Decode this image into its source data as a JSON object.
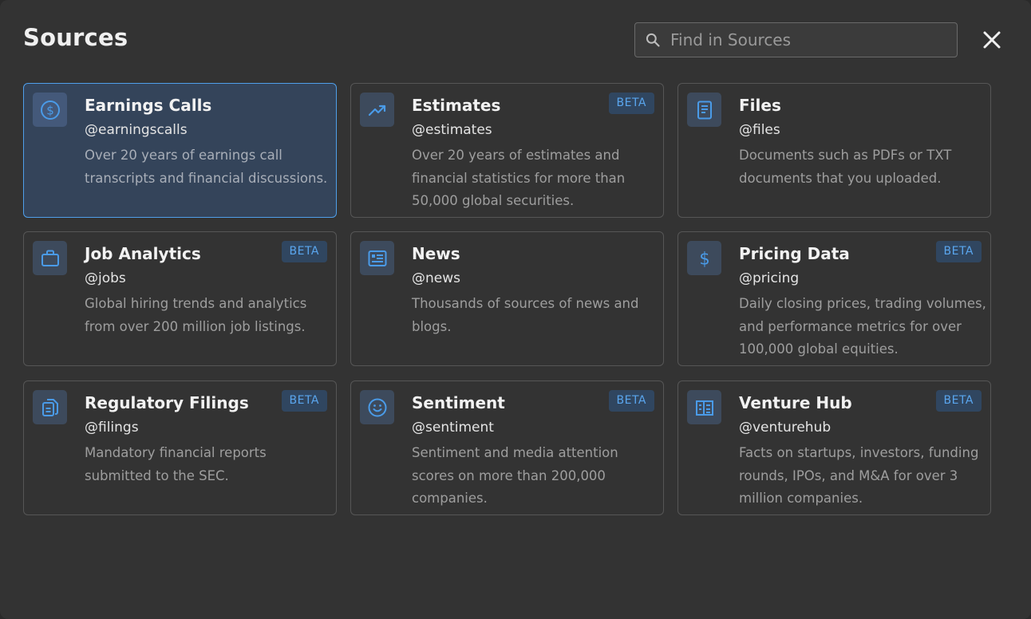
{
  "header": {
    "title": "Sources",
    "search_placeholder": "Find in Sources",
    "search_value": ""
  },
  "colors": {
    "accent": "#4f9fea",
    "badge_text": "#5aa6ee",
    "badge_bg": "#304660",
    "icon_color": "#4a9be8"
  },
  "cards": [
    {
      "name": "Earnings Calls",
      "handle": "@earningscalls",
      "desc": "Over 20 years of earnings call transcripts and financial discussions.",
      "icon": "dollar-circle-icon",
      "badge": "",
      "selected": true
    },
    {
      "name": "Estimates",
      "handle": "@estimates",
      "desc": "Over 20 years of estimates and financial statistics for more than 50,000 global securities.",
      "icon": "trending-up-icon",
      "badge": "BETA",
      "selected": false
    },
    {
      "name": "Files",
      "handle": "@files",
      "desc": "Documents such as PDFs or TXT documents that you uploaded.",
      "icon": "document-icon",
      "badge": "",
      "selected": false
    },
    {
      "name": "Job Analytics",
      "handle": "@jobs",
      "desc": "Global hiring trends and analytics from over 200 million job listings.",
      "icon": "briefcase-icon",
      "badge": "BETA",
      "selected": false
    },
    {
      "name": "News",
      "handle": "@news",
      "desc": "Thousands of sources of news and blogs.",
      "icon": "newspaper-icon",
      "badge": "",
      "selected": false
    },
    {
      "name": "Pricing Data",
      "handle": "@pricing",
      "desc": "Daily closing prices, trading volumes, and performance metrics for over 100,000 global equities.",
      "icon": "dollar-icon",
      "badge": "BETA",
      "selected": false
    },
    {
      "name": "Regulatory Filings",
      "handle": "@filings",
      "desc": "Mandatory financial reports submitted to the SEC.",
      "icon": "filings-icon",
      "badge": "BETA",
      "selected": false
    },
    {
      "name": "Sentiment",
      "handle": "@sentiment",
      "desc": "Sentiment and media attention scores on more than 200,000 companies.",
      "icon": "smiley-icon",
      "badge": "BETA",
      "selected": false
    },
    {
      "name": "Venture Hub",
      "handle": "@venturehub",
      "desc": "Facts on startups, investors, funding rounds, IPOs, and M&A for over 3 million companies.",
      "icon": "building-icon",
      "badge": "BETA",
      "selected": false
    }
  ]
}
